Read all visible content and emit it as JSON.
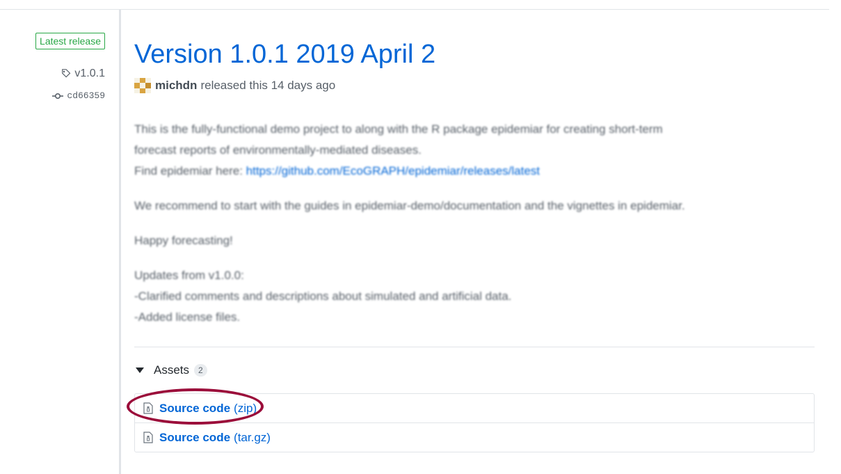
{
  "sidebar": {
    "badge": "Latest release",
    "tag": "v1.0.1",
    "commit": "cd66359"
  },
  "release": {
    "title": "Version 1.0.1 2019 April 2",
    "author": "michdn",
    "released_text": "released this 14 days ago"
  },
  "notes": {
    "p1_line1": "This is the fully-functional demo project to along with the R package epidemiar for creating short-term",
    "p1_line2": "forecast reports of environmentally-mediated diseases.",
    "p1_line3_prefix": "Find epidemiar here: ",
    "p1_link": "https://github.com/EcoGRAPH/epidemiar/releases/latest",
    "p2": "We recommend to start with the guides in epidemiar-demo/documentation and the vignettes in epidemiar.",
    "p3": "Happy forecasting!",
    "p4_line1": "Updates from v1.0.0:",
    "p4_line2": "-Clarified comments and descriptions about simulated and artificial data.",
    "p4_line3": "-Added license files."
  },
  "assets": {
    "label": "Assets",
    "count": "2",
    "items": [
      {
        "name": "Source code",
        "ext": "(zip)"
      },
      {
        "name": "Source code",
        "ext": "(tar.gz)"
      }
    ]
  },
  "colors": {
    "accent": "#0366d6",
    "badge_green": "#28a745",
    "annotation_ring": "#9b0d3a"
  }
}
